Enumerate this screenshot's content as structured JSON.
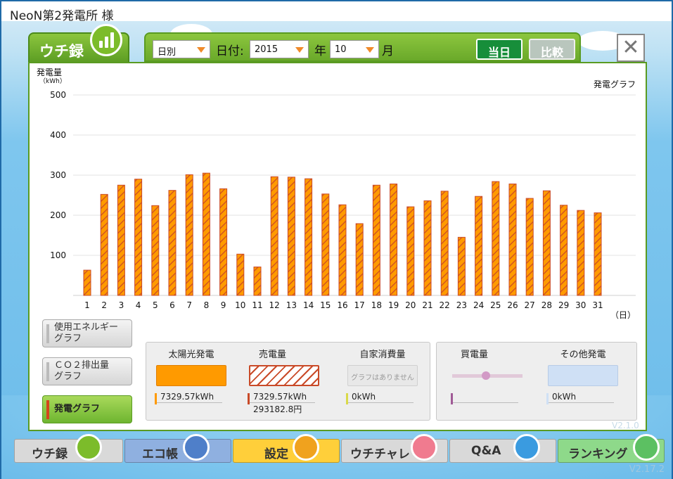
{
  "app": {
    "title": "NeoN第2発電所 様",
    "version": "V2.17.2",
    "panel_version": "V2.1.0"
  },
  "header": {
    "tab_label": "ウチ録",
    "period_select": "日別",
    "date_label": "日付:",
    "year_value": "2015",
    "year_label": "年",
    "month_value": "10",
    "month_label": "月",
    "today_button": "当日",
    "compare_button": "比較",
    "close_glyph": "✕"
  },
  "sidebar": {
    "items": [
      {
        "label_line1": "使用エネルギー",
        "label_line2": "グラフ",
        "active": false
      },
      {
        "label_line1": "ＣＯ２排出量",
        "label_line2": "グラフ",
        "active": false
      },
      {
        "label_line1": "発電グラフ",
        "label_line2": "",
        "active": true
      }
    ]
  },
  "chart_data": {
    "type": "bar",
    "title": "発電グラフ",
    "ylabel": "発電量",
    "yunit": "（kWh）",
    "xlabel": "（日）",
    "ylim": [
      0,
      500
    ],
    "yticks": [
      100,
      200,
      300,
      400,
      500
    ],
    "grid": true,
    "categories": [
      "1",
      "2",
      "3",
      "4",
      "5",
      "6",
      "7",
      "8",
      "9",
      "10",
      "11",
      "12",
      "13",
      "14",
      "15",
      "16",
      "17",
      "18",
      "19",
      "20",
      "21",
      "22",
      "23",
      "24",
      "25",
      "26",
      "27",
      "28",
      "29",
      "30",
      "31"
    ],
    "series": [
      {
        "values": [
          63,
          252,
          275,
          290,
          224,
          262,
          301,
          305,
          266,
          103,
          71,
          296,
          295,
          291,
          253,
          226,
          179,
          275,
          278,
          221,
          236,
          260,
          145,
          247,
          284,
          278,
          242,
          261,
          225,
          212,
          206
        ]
      }
    ],
    "bar_color": "#ff9a00",
    "bar_hatch_color": "#c94a28"
  },
  "legend": {
    "solar": {
      "title": "太陽光発電",
      "value": "7329.57kWh",
      "color": "#ff9a00"
    },
    "sell": {
      "title": "売電量",
      "value": "7329.57kWh",
      "value2": "293182.8円",
      "color": "#c94a28"
    },
    "self": {
      "title": "自家消費量",
      "placeholder": "グラフはありません",
      "value": "0kWh",
      "color": "#d9d94a"
    },
    "buy": {
      "title": "買電量",
      "value": "",
      "color": "#a05a96"
    },
    "other": {
      "title": "その他発電",
      "value": "0kWh",
      "color": "#cfe0f5"
    }
  },
  "nav": {
    "items": [
      {
        "label": "ウチ録",
        "icon": "bar-chart-icon",
        "color": "#d9d9d9",
        "icon_color": "#7cbc2a"
      },
      {
        "label": "エコ帳",
        "icon": "notebook-icon",
        "color": "#8fb0e0",
        "icon_color": "#4f7fc9"
      },
      {
        "label": "設定",
        "icon": "wrench-icon",
        "color": "#ffcf3a",
        "icon_color": "#f0a21e"
      },
      {
        "label": "ウチチャレ",
        "icon": "flag-icon",
        "color": "#d9d9d9",
        "icon_color": "#f07b8f"
      },
      {
        "label": "Q&A",
        "icon": "question-icon",
        "color": "#d9d9d9",
        "icon_color": "#3a9be0"
      },
      {
        "label": "ランキング",
        "icon": "crown-icon",
        "color": "#8ed98a",
        "icon_color": "#5cc062"
      }
    ]
  }
}
